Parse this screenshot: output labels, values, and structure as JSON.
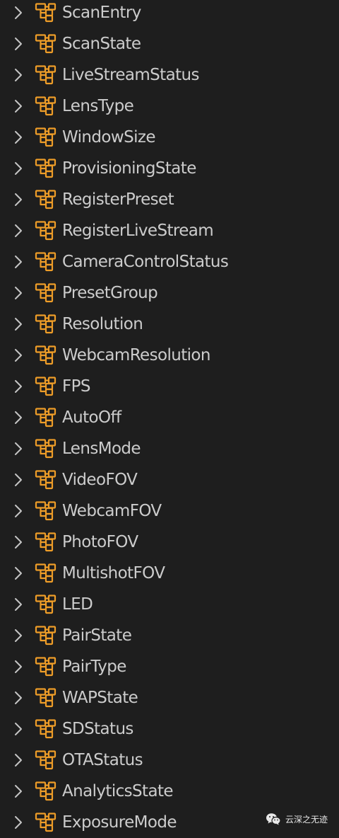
{
  "tree": {
    "items": [
      {
        "label": "ScanEntry"
      },
      {
        "label": "ScanState"
      },
      {
        "label": "LiveStreamStatus"
      },
      {
        "label": "LensType"
      },
      {
        "label": "WindowSize"
      },
      {
        "label": "ProvisioningState"
      },
      {
        "label": "RegisterPreset"
      },
      {
        "label": "RegisterLiveStream"
      },
      {
        "label": "CameraControlStatus"
      },
      {
        "label": "PresetGroup"
      },
      {
        "label": "Resolution"
      },
      {
        "label": "WebcamResolution"
      },
      {
        "label": "FPS"
      },
      {
        "label": "AutoOff"
      },
      {
        "label": "LensMode"
      },
      {
        "label": "VideoFOV"
      },
      {
        "label": "WebcamFOV"
      },
      {
        "label": "PhotoFOV"
      },
      {
        "label": "MultishotFOV"
      },
      {
        "label": "LED"
      },
      {
        "label": "PairState"
      },
      {
        "label": "PairType"
      },
      {
        "label": "WAPState"
      },
      {
        "label": "SDStatus"
      },
      {
        "label": "OTAStatus"
      },
      {
        "label": "AnalyticsState"
      },
      {
        "label": "ExposureMode"
      }
    ],
    "item_icon": "enum-icon",
    "expander_icon": "chevron-right-icon"
  },
  "watermark": {
    "text": "云深之无迹",
    "icon": "wechat-icon"
  },
  "colors": {
    "background": "#1e1e1e",
    "label": "#cccccc",
    "chevron": "#c5c5c5",
    "enum_icon": "#ee9d28"
  }
}
